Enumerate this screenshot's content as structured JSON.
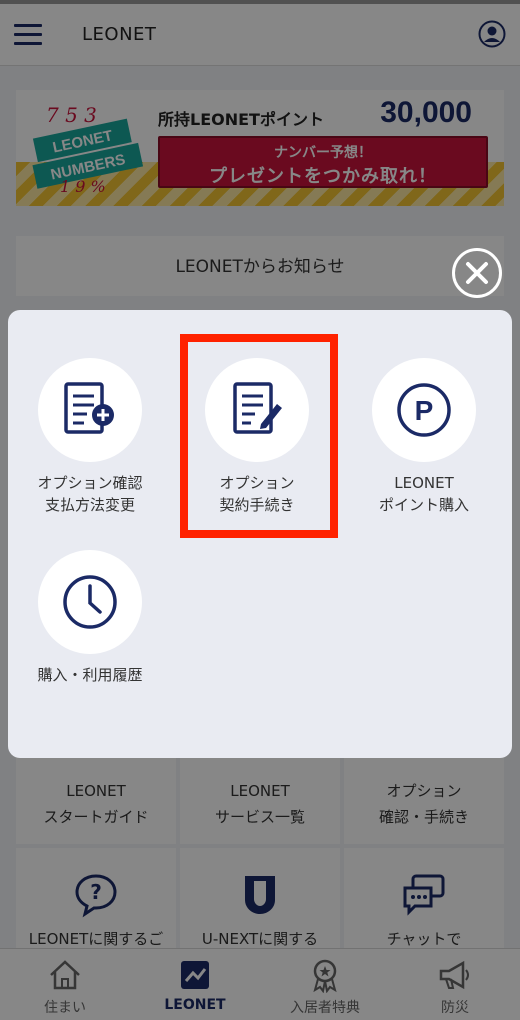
{
  "header": {
    "title": "LEONET"
  },
  "banner": {
    "logo_text": [
      "LEONET",
      "NUMBERS"
    ],
    "points_label": "所持LEONETポイント",
    "points_value": "30,000",
    "cta_line1": "ナンバー予想！",
    "cta_line2": "プレゼントをつかみ取れ！"
  },
  "news": {
    "title": "LEONETからお知らせ"
  },
  "grid": {
    "items": [
      {
        "line1": "LEONET",
        "line2": "スタートガイド"
      },
      {
        "line1": "LEONET",
        "line2": "サービス一覧"
      },
      {
        "line1": "オプション",
        "line2": "確認・手続き"
      },
      {
        "label": "LEONETに関するご"
      },
      {
        "label": "U-NEXTに関する"
      },
      {
        "label": "チャットで"
      }
    ]
  },
  "bottom_nav": {
    "items": [
      {
        "label": "住まい",
        "icon": "house-icon"
      },
      {
        "label": "LEONET",
        "icon": "leonet-icon"
      },
      {
        "label": "入居者特典",
        "icon": "ribbon-award-icon"
      },
      {
        "label": "防災",
        "icon": "megaphone-icon"
      }
    ]
  },
  "modal": {
    "items": [
      {
        "line1": "オプション確認",
        "line2": "支払方法変更",
        "icon": "document-plus-icon"
      },
      {
        "line1": "オプション",
        "line2": "契約手続き",
        "icon": "document-edit-icon"
      },
      {
        "line1": "LEONET",
        "line2": "ポイント購入",
        "icon": "p-circle-icon"
      },
      {
        "line1": "購入・利用履歴",
        "icon": "clock-icon"
      }
    ]
  },
  "colors": {
    "brand_navy": "#1b2a66",
    "highlight_red": "#ff2200",
    "cta_red": "#c8143c"
  }
}
